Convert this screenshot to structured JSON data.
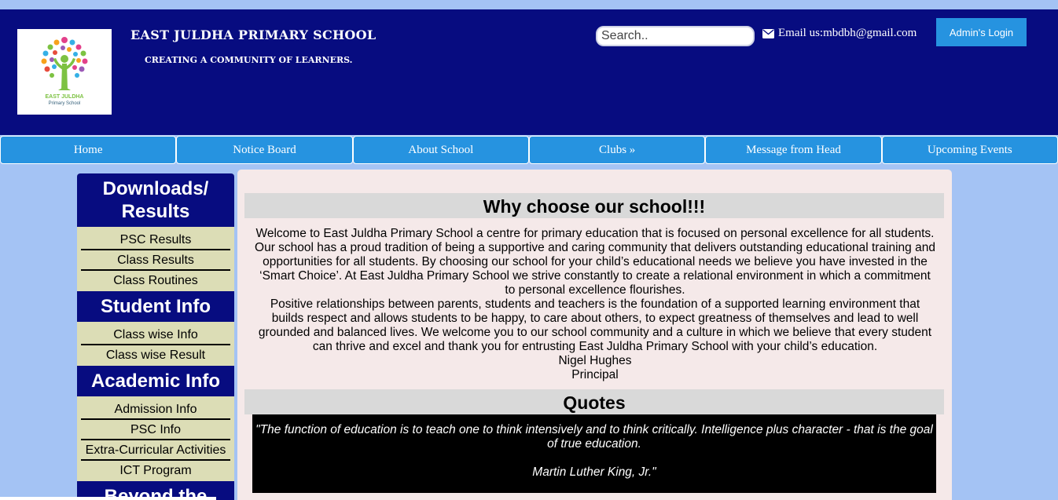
{
  "header": {
    "school_name": "EAST JULDHA PRIMARY SCHOOL",
    "tagline": "CREATING A COMMUNITY OF LEARNERS.",
    "logo_text_line1": "EAST JULDHA",
    "logo_text_line2": "Primary School",
    "search_placeholder": "Search..",
    "email_label": "Email us:mbdbh@gmail.com",
    "admin_button": "Admin's Login"
  },
  "nav": {
    "items": [
      "Home",
      "Notice Board",
      "About School",
      "Clubs »",
      "Message from Head",
      "Upcoming Events"
    ]
  },
  "sidebar": {
    "sections": [
      {
        "title": "Downloads/ Results",
        "links": [
          "PSC Results",
          "Class Results",
          "Class Routines"
        ]
      },
      {
        "title": "Student Info",
        "links": [
          "Class wise Info",
          "Class wise Result"
        ]
      },
      {
        "title": "Academic Info",
        "links": [
          "Admission Info",
          "PSC Info",
          "Extra-Curricular Activities",
          "ICT Program"
        ]
      },
      {
        "title": "Beyond the",
        "links": []
      }
    ]
  },
  "main": {
    "why_title": "Why choose our school!!!",
    "welcome_p1": "Welcome to East Juldha Primary School a centre for primary education that is focused on personal excellence for all students. Our school has a proud tradition of being a supportive and caring community that delivers outstanding educational training and opportunities for all students. By choosing our school for your child’s educational needs we believe you have invested in the ‘Smart Choice’. At East Juldha Primary School we strive constantly to create a relational environment in which a commitment to personal excellence flourishes.",
    "welcome_p2": "Positive relationships between parents, students and teachers is the foundation of a supported learning environment that builds respect and allows students to be happy, to care about others, to expect greatness of themselves and lead to well grounded and balanced lives. We welcome you to our school community and a culture in which we believe that every student can thrive and excel and thank you for entrusting East Juldha Primary School with your child’s education.",
    "signatory_name": "Nigel Hughes",
    "signatory_title": "Principal",
    "quotes_title": "Quotes",
    "quote_text": "\"The function of education is to teach one to think intensively and to think critically. Intelligence plus character - that is the goal of true education.",
    "quote_author": "Martin Luther King, Jr.\""
  },
  "colors": {
    "header_bg": "#070c80",
    "nav_bg": "#2693e0",
    "page_bg": "#a4c3f4",
    "sidebar_bg": "#dcddb6",
    "main_bg": "#f5e9e9"
  }
}
